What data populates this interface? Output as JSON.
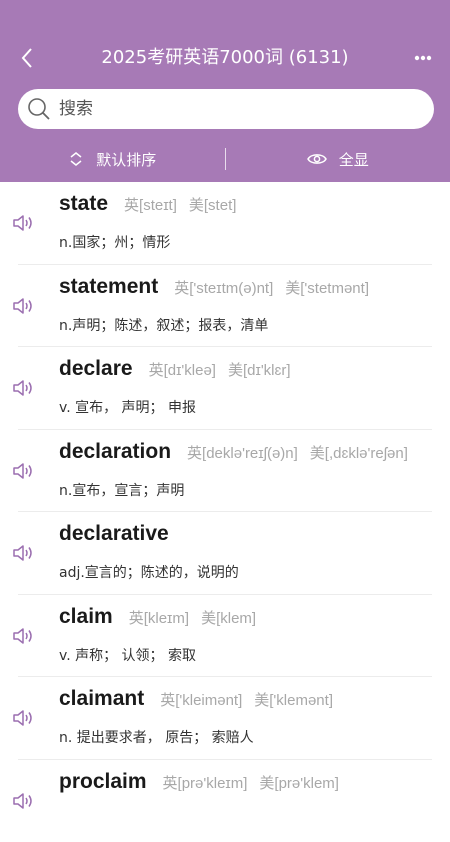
{
  "header": {
    "title": "2025考研英语7000词 (6131)",
    "back_icon": "chevron-left-icon",
    "more_icon": "more-dots-icon",
    "bg_color": "#a77ab6"
  },
  "search": {
    "placeholder": "搜索",
    "value": ""
  },
  "filters": {
    "sort_label": "默认排序",
    "display_label": "全显"
  },
  "words": [
    {
      "word": "state",
      "uk": "英[steɪt]",
      "us": "美[stet]",
      "def": "n.国家；州；情形"
    },
    {
      "word": "statement",
      "uk": "英['steɪtm(ə)nt]",
      "us": "美['stetmənt]",
      "def": "n.声明；陈述，叙述；报表，清单"
    },
    {
      "word": "declare",
      "uk": "英[dɪ'kleə]",
      "us": "美[dɪ'klɛr]",
      "def": "v. 宣布， 声明； 申报"
    },
    {
      "word": "declaration",
      "uk": "英[deklə'reɪʃ(ə)n]",
      "us": "美[,dɛklə'reʃən]",
      "def": "n.宣布，宣言；声明"
    },
    {
      "word": "declarative",
      "uk": "",
      "us": "",
      "def": "adj.宣言的；陈述的，说明的"
    },
    {
      "word": "claim",
      "uk": "英[kleɪm]",
      "us": "美[klem]",
      "def": "v. 声称； 认领； 索取"
    },
    {
      "word": "claimant",
      "uk": "英['kleimənt]",
      "us": "美['klemənt]",
      "def": "n. 提出要求者， 原告； 索赔人"
    },
    {
      "word": "proclaim",
      "uk": "英[prə'kleɪm]",
      "us": "美[prə'klem]",
      "def": ""
    }
  ]
}
